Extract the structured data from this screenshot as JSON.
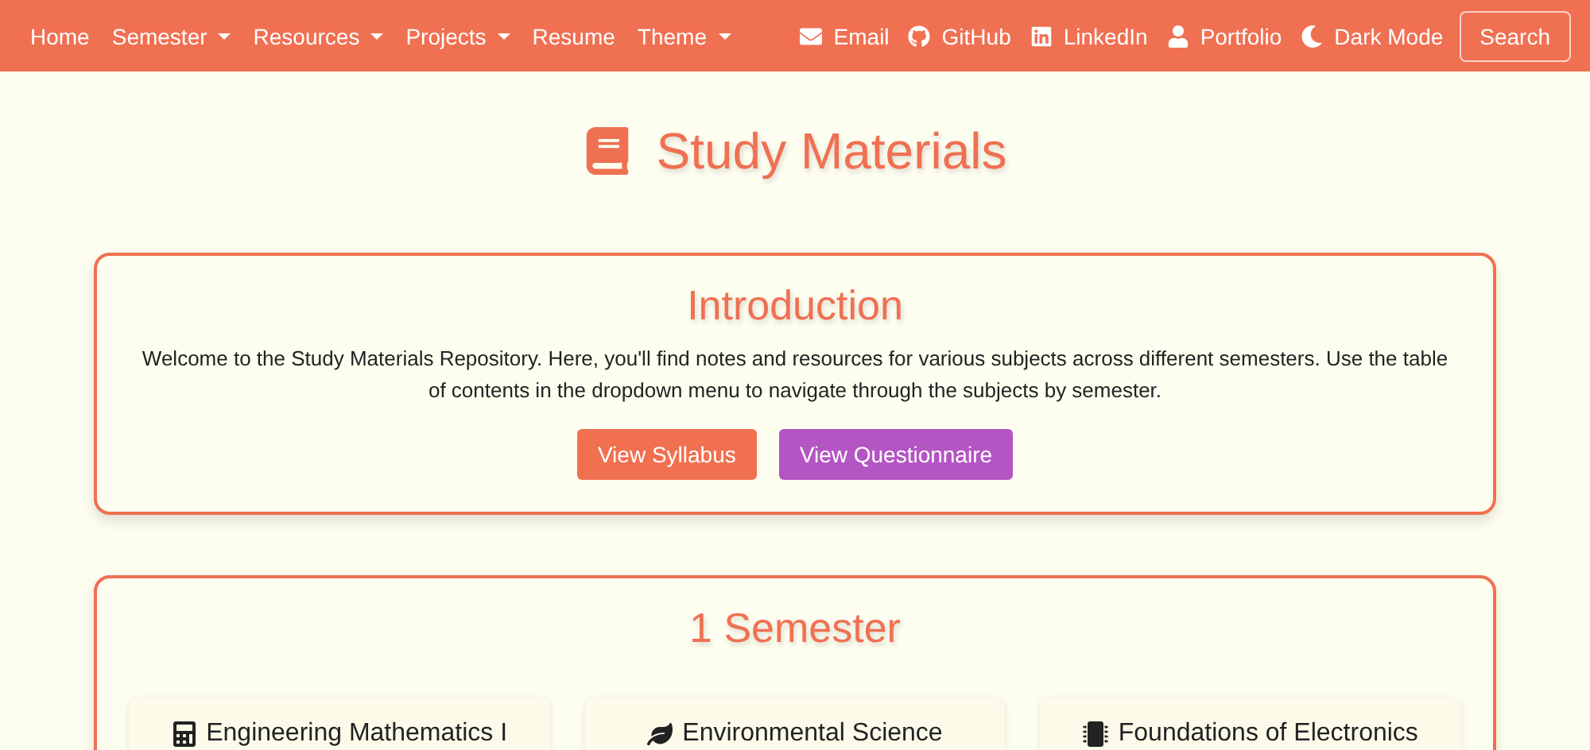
{
  "navbar": {
    "left_items": [
      {
        "label": "Home",
        "dropdown": false
      },
      {
        "label": "Semester",
        "dropdown": true
      },
      {
        "label": "Resources",
        "dropdown": true
      },
      {
        "label": "Projects",
        "dropdown": true
      },
      {
        "label": "Resume",
        "dropdown": false
      },
      {
        "label": "Theme",
        "dropdown": true
      }
    ],
    "right_items": [
      {
        "label": "Email"
      },
      {
        "label": "GitHub"
      },
      {
        "label": "LinkedIn"
      },
      {
        "label": "Portfolio"
      },
      {
        "label": "Dark Mode"
      }
    ],
    "search_button": "Search"
  },
  "page_title": "Study Materials",
  "introduction": {
    "heading": "Introduction",
    "text": "Welcome to the Study Materials Repository. Here, you'll find notes and resources for various subjects across different semesters. Use the table of contents in the dropdown menu to navigate through the subjects by semester.",
    "buttons": [
      {
        "label": "View Syllabus",
        "color": "#f07050"
      },
      {
        "label": "View Questionnaire",
        "color": "#b455c4"
      }
    ]
  },
  "semester": {
    "heading": "1 Semester",
    "subjects": [
      {
        "title": "Engineering Mathematics I"
      },
      {
        "title": "Environmental Science"
      },
      {
        "title": "Foundations of Electronics"
      }
    ]
  }
}
